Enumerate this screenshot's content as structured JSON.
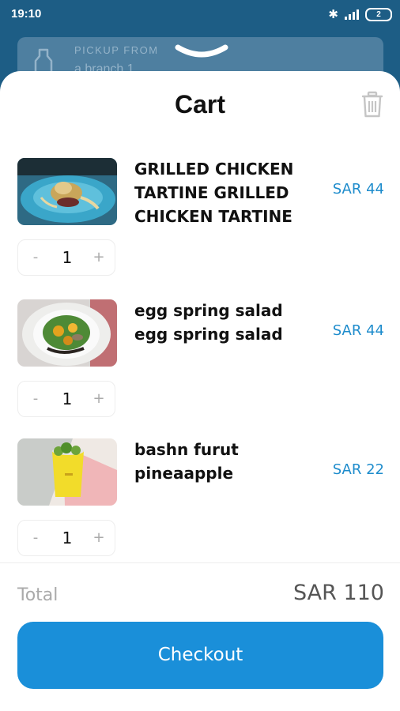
{
  "status_bar": {
    "time": "19:10",
    "battery": "2",
    "icons": [
      "bluetooth-icon",
      "signal-icon",
      "battery-icon"
    ]
  },
  "pickup": {
    "label": "PICKUP FROM",
    "branch": "a branch 1"
  },
  "cart": {
    "title": "Cart",
    "items": [
      {
        "name": "GRILLED CHICKEN TARTINE GRILLED CHICKEN TARTINE",
        "price": "SAR 44",
        "quantity": "1",
        "minus": "-",
        "plus": "+"
      },
      {
        "name": "egg  spring salad egg  spring salad",
        "price": "SAR 44",
        "quantity": "1",
        "minus": "-",
        "plus": "+"
      },
      {
        "name": "bashn furut pineaapple",
        "price": "SAR 22",
        "quantity": "1",
        "minus": "-",
        "plus": "+"
      }
    ],
    "total_label": "Total",
    "total_value": "SAR 110",
    "checkout_label": "Checkout"
  },
  "colors": {
    "header_bg": "#1d5d85",
    "accent": "#1a8fd9",
    "price": "#1e8ccc"
  }
}
